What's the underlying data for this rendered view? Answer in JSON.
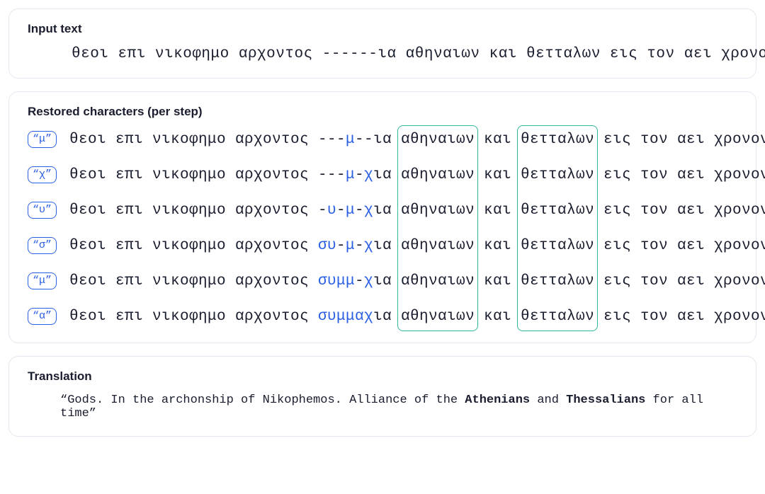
{
  "panels": {
    "input": {
      "title": "Input text"
    },
    "restored": {
      "title": "Restored characters (per step)"
    },
    "translation": {
      "title": "Translation"
    }
  },
  "input_line": "θεοι επι νικοφημο αρχοντος ------ια αθηναιων και θετταλων εις τον αει χρονον",
  "colors": {
    "hl_vlight": "rgba(124,58,237,0.07)",
    "hl_light": "rgba(124,58,237,0.18)",
    "hl_mid": "rgba(124,58,237,0.40)",
    "hl_dark": "rgba(124,58,237,0.70)"
  },
  "words_before": [
    "θεοι",
    "επι",
    "νικοφημο",
    "αρχοντος"
  ],
  "words_after": [
    "αθηναιων",
    "και",
    "θετταλων",
    "εις",
    "τον",
    "αει",
    "χρονον"
  ],
  "steps": [
    {
      "chip": "“μ”",
      "middle": [
        {
          "c": "-"
        },
        {
          "c": "-"
        },
        {
          "c": "-"
        },
        {
          "c": "μ",
          "new": true,
          "hl": "dark"
        },
        {
          "c": "-",
          "hl": "mid"
        },
        {
          "c": "-"
        },
        {
          "c": "ι",
          "hl": "dark"
        },
        {
          "c": "α",
          "hl": "dark"
        }
      ],
      "after_hl": {
        "0": {
          "0": "light",
          "1": "vlight",
          "4": "vlight"
        },
        "2": {
          "0": "light",
          "3": "light",
          "4": "vlight"
        },
        "5": {
          "0": "vlight"
        }
      }
    },
    {
      "chip": "“χ”",
      "middle": [
        {
          "c": "-"
        },
        {
          "c": "-"
        },
        {
          "c": "-"
        },
        {
          "c": "μ",
          "restored": true,
          "hl": "dark"
        },
        {
          "c": "-",
          "hl": "mid"
        },
        {
          "c": "χ",
          "new": true,
          "hl": "light"
        },
        {
          "c": "ι",
          "hl": "mid"
        },
        {
          "c": "α",
          "hl": "light"
        }
      ],
      "after_hl": {
        "0": {
          "0": "light",
          "4": "vlight"
        },
        "2": {
          "0": "light",
          "3": "light",
          "4": "vlight"
        }
      }
    },
    {
      "chip": "“υ”",
      "middle": [
        {
          "c": "-"
        },
        {
          "c": "υ",
          "new": true,
          "hl": "light"
        },
        {
          "c": "-",
          "hl": "mid"
        },
        {
          "c": "μ",
          "restored": true,
          "hl": "dark"
        },
        {
          "c": "-",
          "hl": "mid"
        },
        {
          "c": "χ",
          "restored": true,
          "hl": "mid"
        },
        {
          "c": "ι",
          "hl": "mid"
        },
        {
          "c": "α",
          "hl": "light"
        }
      ],
      "after_hl": {
        "0": {
          "0": "light",
          "4": "vlight"
        },
        "2": {
          "0": "light",
          "3": "light",
          "4": "vlight",
          "7": "vlight"
        },
        "5": {
          "0": "vlight"
        }
      }
    },
    {
      "chip": "“σ”",
      "middle": [
        {
          "c": "σ",
          "new": true,
          "hl": "light"
        },
        {
          "c": "υ",
          "restored": true,
          "hl": "dark"
        },
        {
          "c": "-",
          "hl": "mid"
        },
        {
          "c": "μ",
          "restored": true,
          "hl": "dark"
        },
        {
          "c": "-",
          "hl": "mid"
        },
        {
          "c": "χ",
          "restored": true,
          "hl": "mid"
        },
        {
          "c": "ι",
          "hl": "mid"
        },
        {
          "c": "α",
          "hl": "light"
        }
      ],
      "after_hl": {
        "0": {
          "0": "vlight"
        },
        "2": {
          "0": "light",
          "3": "vlight",
          "4": "vlight",
          "7": "vlight"
        }
      }
    },
    {
      "chip": "“μ”",
      "middle": [
        {
          "c": "σ",
          "restored": true,
          "hl": "mid"
        },
        {
          "c": "υ",
          "restored": true,
          "hl": "mid"
        },
        {
          "c": "μ",
          "new": true,
          "hl": "dark"
        },
        {
          "c": "μ",
          "restored": true,
          "hl": "dark"
        },
        {
          "c": "-",
          "hl": "mid"
        },
        {
          "c": "χ",
          "restored": true,
          "hl": "mid"
        },
        {
          "c": "ι",
          "hl": "mid"
        },
        {
          "c": "α",
          "hl": "light"
        }
      ],
      "after_hl": {
        "0": {
          "0": "vlight",
          "4": "vlight"
        },
        "2": {
          "0": "light",
          "3": "vlight",
          "4": "vlight",
          "7": "vlight"
        }
      }
    },
    {
      "chip": "“α”",
      "middle": [
        {
          "c": "σ",
          "restored": true,
          "hl": "mid"
        },
        {
          "c": "υ",
          "restored": true,
          "hl": "mid"
        },
        {
          "c": "μ",
          "restored": true,
          "hl": "dark"
        },
        {
          "c": "μ",
          "restored": true,
          "hl": "dark"
        },
        {
          "c": "α",
          "new": true,
          "hl": "mid"
        },
        {
          "c": "χ",
          "restored": true,
          "hl": "dark"
        },
        {
          "c": "ι",
          "hl": "mid"
        },
        {
          "c": "α",
          "hl": "mid"
        }
      ],
      "after_hl": {
        "0": {
          "0": "vlight",
          "4": "vlight"
        },
        "2": {
          "0": "light",
          "3": "vlight",
          "4": "vlight",
          "7": "vlight"
        }
      }
    }
  ],
  "before_hl": {},
  "translation": {
    "prefix": "“Gods. In the archonship of Nikophemos. Alliance of the ",
    "b1": "Athenians",
    "mid": " and ",
    "b2": "Thessalians",
    "suffix": " for all time”"
  },
  "green_boxes": [
    {
      "word_after_index": 0
    },
    {
      "word_after_index": 2
    }
  ]
}
